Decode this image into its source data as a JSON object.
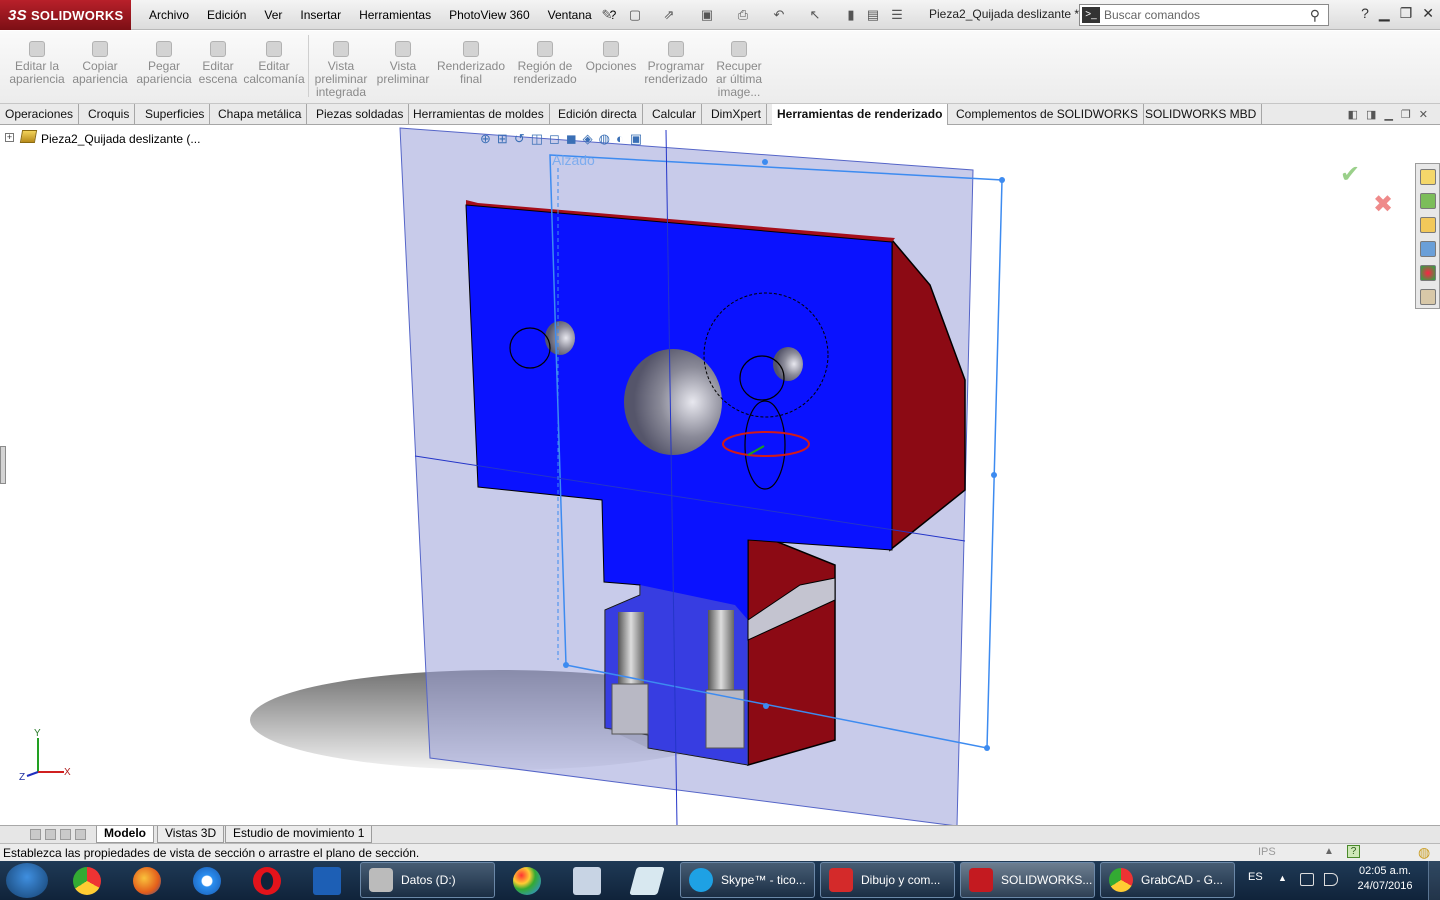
{
  "app": {
    "logo": "SOLIDWORKS",
    "doc_title": "Pieza2_Quijada deslizante *"
  },
  "menu": [
    "Archivo",
    "Edición",
    "Ver",
    "Insertar",
    "Herramientas",
    "PhotoView 360",
    "Ventana",
    "?"
  ],
  "search": {
    "placeholder": "Buscar comandos"
  },
  "ribbon": [
    {
      "label": "Editar la apariencia"
    },
    {
      "label": "Copiar apariencia"
    },
    {
      "label": "Pegar apariencia"
    },
    {
      "label": "Editar escena"
    },
    {
      "label": "Editar calcomanía"
    },
    {
      "label": "Vista preliminar integrada"
    },
    {
      "label": "Vista preliminar"
    },
    {
      "label": "Renderizado final"
    },
    {
      "label": "Región de renderizado"
    },
    {
      "label": "Opciones"
    },
    {
      "label": "Programar renderizado"
    },
    {
      "label": "Recuper ar última image..."
    }
  ],
  "tabs": [
    "Operaciones",
    "Croquis",
    "Superficies",
    "Chapa metálica",
    "Piezas soldadas",
    "Herramientas de moldes",
    "Edición directa",
    "Calcular",
    "DimXpert",
    "Herramientas de renderizado",
    "Complementos de SOLIDWORKS",
    "SOLIDWORKS MBD"
  ],
  "active_tab": "Herramientas de renderizado",
  "tree": {
    "root": "Pieza2_Quijada deslizante  (..."
  },
  "viewport": {
    "plane_label": "Alzado",
    "triad": {
      "x": "X",
      "y": "Y",
      "z": "Z"
    },
    "part_color": "#0a12ff",
    "section_color": "#8c0a14",
    "plane_color": "#9aa0d8"
  },
  "bottom_tabs": [
    "Modelo",
    "Vistas 3D",
    "Estudio de movimiento 1"
  ],
  "status": {
    "message": "Establezca las propiedades de vista de sección o arrastre el plano de sección.",
    "units": "IPS"
  },
  "taskbar": {
    "tasks": [
      {
        "label": "Datos (D:)"
      },
      {
        "label": "Skype™ - tico..."
      },
      {
        "label": "Dibujo y com..."
      },
      {
        "label": "SOLIDWORKS..."
      },
      {
        "label": "GrabCAD - G..."
      }
    ],
    "language": "ES",
    "time": "02:05 a.m.",
    "date": "24/07/2016"
  }
}
